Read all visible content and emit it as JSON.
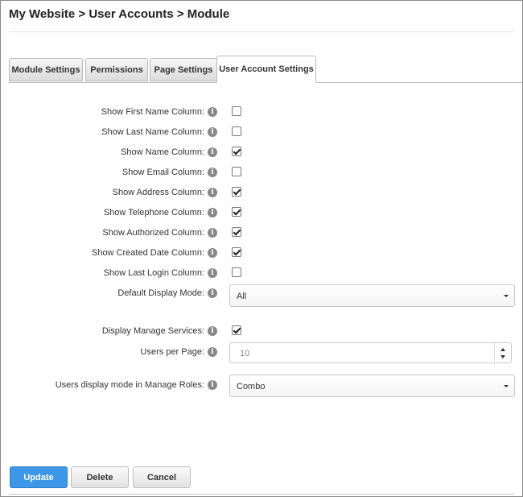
{
  "page": {
    "title": "My Website > User Accounts > Module"
  },
  "tabs": [
    {
      "label": "Module Settings"
    },
    {
      "label": "Permissions"
    },
    {
      "label": "Page Settings"
    },
    {
      "label": "User Account Settings",
      "active": true
    }
  ],
  "fields": {
    "show_first_name": {
      "label": "Show First Name Column:",
      "checked": false
    },
    "show_last_name": {
      "label": "Show Last Name Column:",
      "checked": false
    },
    "show_name": {
      "label": "Show Name Column:",
      "checked": true
    },
    "show_email": {
      "label": "Show Email Column:",
      "checked": false
    },
    "show_address": {
      "label": "Show Address Column:",
      "checked": true
    },
    "show_telephone": {
      "label": "Show Telephone Column:",
      "checked": true
    },
    "show_authorized": {
      "label": "Show Authorized Column:",
      "checked": true
    },
    "show_created_date": {
      "label": "Show Created Date Column:",
      "checked": true
    },
    "show_last_login": {
      "label": "Show Last Login Column:",
      "checked": false
    },
    "default_display_mode": {
      "label": "Default Display Mode:",
      "value": "All"
    },
    "display_manage_services": {
      "label": "Display Manage Services:",
      "checked": true
    },
    "users_per_page": {
      "label": "Users per Page:",
      "value": "10"
    },
    "users_display_mode_roles": {
      "label": "Users display mode in Manage Roles:",
      "value": "Combo"
    }
  },
  "info_icon": "info-circle",
  "buttons": {
    "update": "Update",
    "delete": "Delete",
    "cancel": "Cancel"
  },
  "colors": {
    "primary": "#3e96e6"
  }
}
